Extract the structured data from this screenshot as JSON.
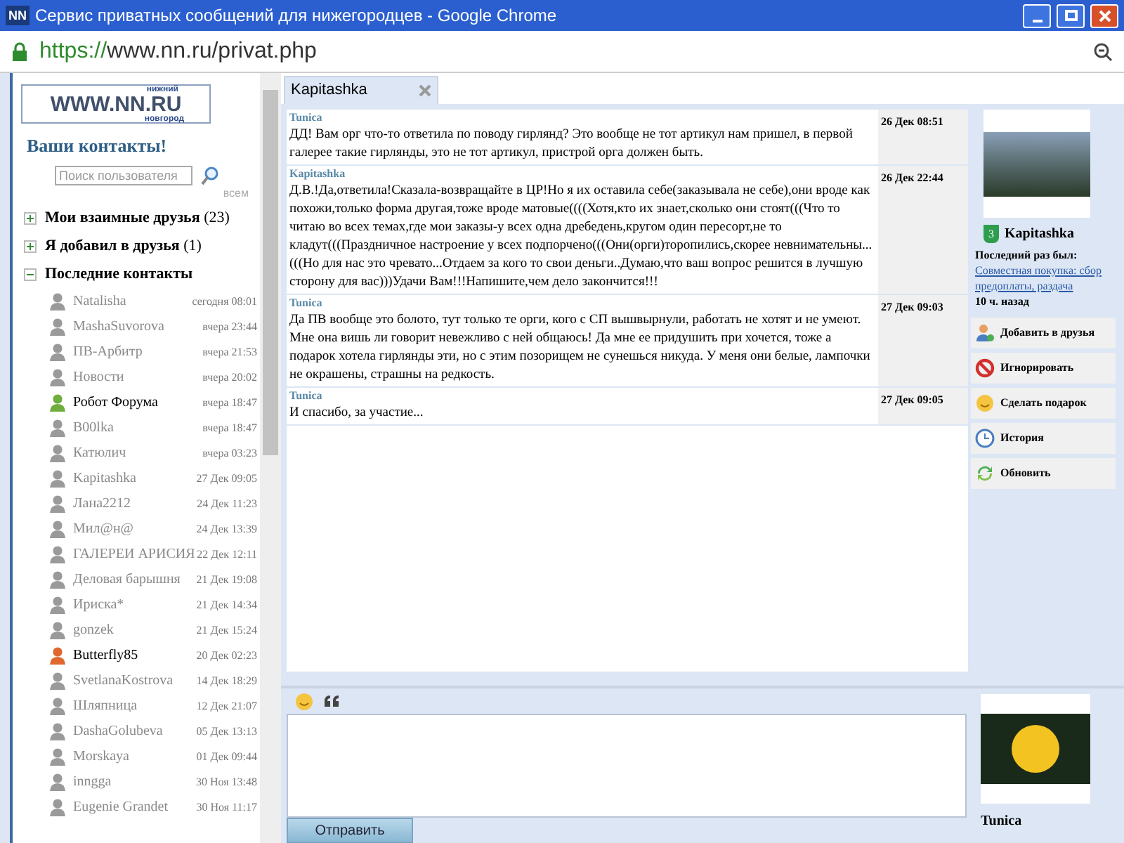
{
  "window": {
    "title": "Сервис приватных сообщений для нижегородцев - Google Chrome",
    "favicon": "NN"
  },
  "address_bar": {
    "scheme": "https://",
    "rest": "www.nn.ru/privat.php"
  },
  "sidebar": {
    "logo": {
      "top": "нижний",
      "main": "WWW.NN.RU",
      "bottom": "новгород"
    },
    "heading": "Ваши контакты!",
    "search": {
      "placeholder": "Поиск пользователя"
    },
    "sort_label": "всем",
    "groups": [
      {
        "label": "Мои взаимные друзья",
        "count": "(23)",
        "expanded": false
      },
      {
        "label": "Я добавил в друзья",
        "count": "(1)",
        "expanded": false
      },
      {
        "label": "Последние контакты",
        "expanded": true,
        "children": [
          {
            "name": "Natalisha",
            "time": "сегодня 08:01",
            "online": false,
            "color": "#9a9a9a"
          },
          {
            "name": "MashaSuvorova",
            "time": "вчера 23:44",
            "online": false,
            "color": "#9a9a9a"
          },
          {
            "name": "ПВ-Арбитр",
            "time": "вчера 21:53",
            "online": false,
            "color": "#9a9a9a"
          },
          {
            "name": "Новости",
            "time": "вчера 20:02",
            "online": false,
            "color": "#9a9a9a"
          },
          {
            "name": "Робот Форума",
            "time": "вчера 18:47",
            "online": true,
            "color": "#6fae3c"
          },
          {
            "name": "B00lka",
            "time": "вчера 18:47",
            "online": false,
            "color": "#9a9a9a"
          },
          {
            "name": "Катюлич",
            "time": "вчера 03:23",
            "online": false,
            "color": "#9a9a9a"
          },
          {
            "name": "Kapitashka",
            "time": "27 Дек 09:05",
            "online": false,
            "color": "#9a9a9a"
          },
          {
            "name": "Лана2212",
            "time": "24 Дек 11:23",
            "online": false,
            "color": "#9a9a9a"
          },
          {
            "name": "Мил@н@",
            "time": "24 Дек 13:39",
            "online": false,
            "color": "#9a9a9a"
          },
          {
            "name": "ГАЛЕРЕИ АРИСИЯ",
            "time": "22 Дек 12:11",
            "online": false,
            "color": "#9a9a9a"
          },
          {
            "name": "Деловая барышня",
            "time": "21 Дек 19:08",
            "online": false,
            "color": "#9a9a9a"
          },
          {
            "name": "Ириска*",
            "time": "21 Дек 14:34",
            "online": false,
            "color": "#9a9a9a"
          },
          {
            "name": "gonzek",
            "time": "21 Дек 15:24",
            "online": false,
            "color": "#9a9a9a"
          },
          {
            "name": "Butterfly85",
            "time": "20 Дек 02:23",
            "online": true,
            "color": "#e0682f"
          },
          {
            "name": "SvetlanaKostrova",
            "time": "14 Дек 18:29",
            "online": false,
            "color": "#9a9a9a"
          },
          {
            "name": "Шляпница",
            "time": "12 Дек 21:07",
            "online": false,
            "color": "#9a9a9a"
          },
          {
            "name": "DashaGolubeva",
            "time": "05 Дек 13:13",
            "online": false,
            "color": "#9a9a9a"
          },
          {
            "name": "Morskaya",
            "time": "01 Дек 09:44",
            "online": false,
            "color": "#9a9a9a"
          },
          {
            "name": "inngga",
            "time": "30 Ноя 13:48",
            "online": false,
            "color": "#9a9a9a"
          },
          {
            "name": "Eugenie Grandet",
            "time": "30 Ноя 11:17",
            "online": false,
            "color": "#9a9a9a"
          }
        ]
      }
    ]
  },
  "tabs": [
    {
      "label": "Kapitashka",
      "selected": true
    }
  ],
  "messages": [
    {
      "author": "Tunica",
      "date": "26 Дек 08:51",
      "text": "ДД! Вам орг что-то ответила по поводу гирлянд? Это вообще не тот артикул нам пришел, в первой галерее такие гирлянды, это не тот артикул, пристрой орга должен быть."
    },
    {
      "author": "Kapitashka",
      "date": "26 Дек 22:44",
      "text": "Д.В.!Да,ответила!Сказала-возвращайте в ЦР!Но я их оставила себе(заказывала не себе),они вроде как похожи,только форма другая,тоже вроде матовые((((Хотя,кто их знает,сколько они стоят(((Что то читаю во всех темах,где мои заказы-у всех одна дребедень,кругом один пересорт,не то кладут(((Праздничное настроение у всех подпорчено(((Они(орги)торопились,скорее невнимательны...(((Но для нас это чревато...Отдаем за кого то свои деньги..Думаю,что ваш вопрос решится в лучшую сторону для вас)))Удачи Вам!!!Напишите,чем дело закончится!!!"
    },
    {
      "author": "Tunica",
      "date": "27 Дек 09:03",
      "text": "Да ПВ вообще это болото, тут только те орги, кого с СП вышвырнули, работать не хотят и не умеют. Мне она вишь ли говорит невежливо с ней общаюсь! Да мне ее придушить при хочется, тоже а подарок хотела гирлянды эти, но с этим позорищем не сунешься никуда. У меня они белые, лампочки не окрашены, страшны на редкость."
    },
    {
      "author": "Tunica",
      "date": "27 Дек 09:05",
      "text": "И спасибо, за участие..."
    }
  ],
  "profile": {
    "badge": "3",
    "name": "Kapitashka",
    "last_seen_label": "Последний раз был:",
    "last_seen_link": "Совместная покупка: сбор предоплаты, раздача",
    "last_seen_time": "10 ч. назад"
  },
  "actions": [
    {
      "kind": "add",
      "label": "Добавить в друзья"
    },
    {
      "kind": "ignore",
      "label": "Игнорировать"
    },
    {
      "kind": "gift",
      "label": "Сделать подарок"
    },
    {
      "kind": "history",
      "label": "История"
    },
    {
      "kind": "refresh",
      "label": "Обновить"
    }
  ],
  "composer": {
    "send_button": "Отправить",
    "own_name": "Tunica"
  }
}
